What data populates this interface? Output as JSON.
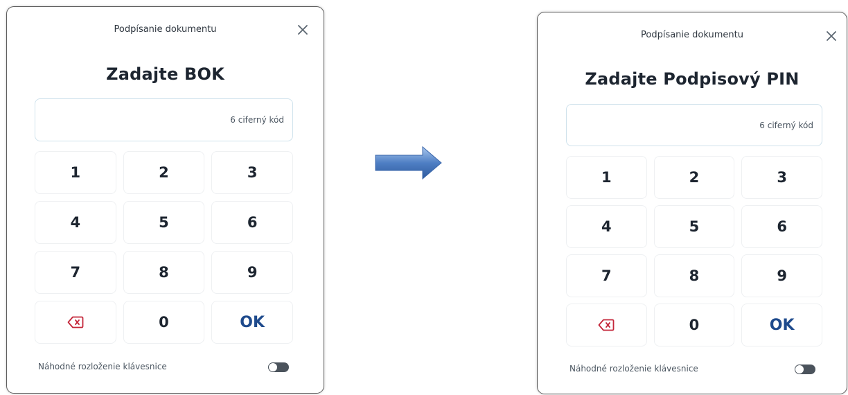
{
  "left_dialog": {
    "title": "Podpísanie dokumentu",
    "heading": "Zadajte BOK",
    "input_placeholder": "6 ciferný kód",
    "keys": [
      "1",
      "2",
      "3",
      "4",
      "5",
      "6",
      "7",
      "8",
      "9",
      "",
      "0",
      "OK"
    ],
    "footer_label": "Náhodné rozloženie klávesnice",
    "toggle_on": false
  },
  "right_dialog": {
    "title": "Podpísanie dokumentu",
    "heading": "Zadajte Podpisový PIN",
    "input_placeholder": "6 ciferný kód",
    "keys": [
      "1",
      "2",
      "3",
      "4",
      "5",
      "6",
      "7",
      "8",
      "9",
      "",
      "0",
      "OK"
    ],
    "footer_label": "Náhodné rozloženie klávesnice",
    "toggle_on": false
  },
  "icons": {
    "close": "close-icon",
    "backspace": "backspace-icon",
    "arrow": "right-arrow-icon"
  },
  "colors": {
    "ok": "#1e4a8c",
    "backspace": "#c4263a",
    "arrow": "#4f7fc4",
    "toggle": "#4b535c"
  }
}
